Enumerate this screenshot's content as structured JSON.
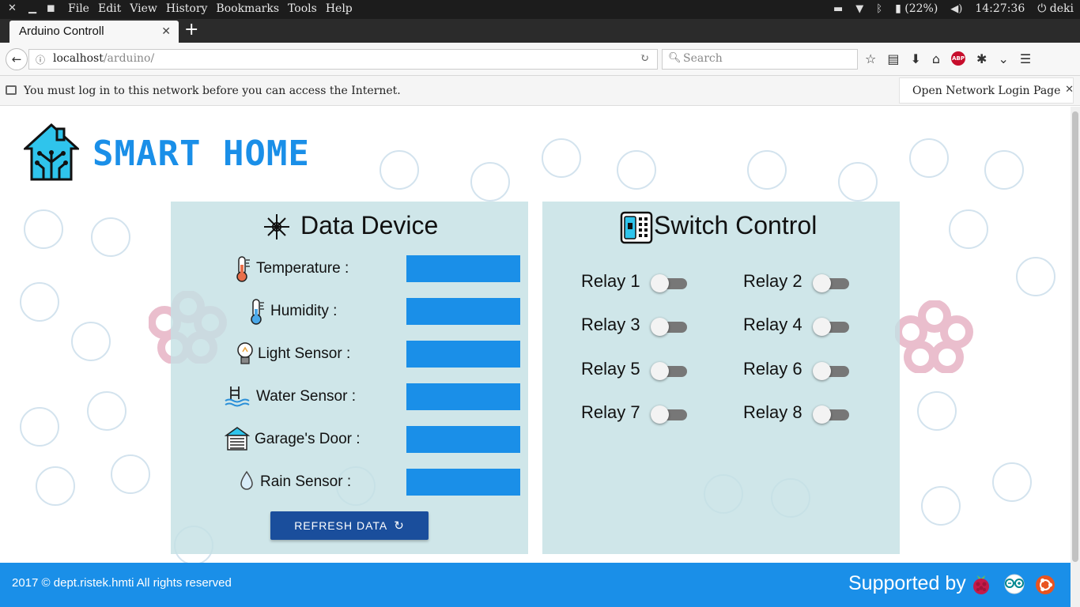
{
  "system_bar": {
    "menus": [
      "File",
      "Edit",
      "View",
      "History",
      "Bookmarks",
      "Tools",
      "Help"
    ],
    "battery": "(22%)",
    "clock": "14:27:36",
    "user": "deki"
  },
  "tab": {
    "title": "Arduino Controll"
  },
  "address": {
    "host": "localhost",
    "path": "/arduino/",
    "search_placeholder": "Search"
  },
  "notification": {
    "message": "You must log in to this network before you can access the Internet.",
    "button": "Open Network Login Page"
  },
  "brand": {
    "title": "SMART HOME"
  },
  "data_device": {
    "title": "Data Device",
    "sensors": [
      {
        "label": "Temperature :",
        "icon": "thermometer-icon",
        "value": ""
      },
      {
        "label": "Humidity :",
        "icon": "humidity-icon",
        "value": ""
      },
      {
        "label": "Light Sensor :",
        "icon": "bulb-icon",
        "value": ""
      },
      {
        "label": "Water Sensor :",
        "icon": "water-icon",
        "value": ""
      },
      {
        "label": "Garage's Door :",
        "icon": "garage-icon",
        "value": ""
      },
      {
        "label": "Rain Sensor :",
        "icon": "raindrop-icon",
        "value": ""
      }
    ],
    "refresh_label": "REFRESH DATA"
  },
  "switch_control": {
    "title": "Switch Control",
    "relays": [
      {
        "label": "Relay 1",
        "on": false
      },
      {
        "label": "Relay 2",
        "on": false
      },
      {
        "label": "Relay 3",
        "on": false
      },
      {
        "label": "Relay 4",
        "on": false
      },
      {
        "label": "Relay 5",
        "on": false
      },
      {
        "label": "Relay 6",
        "on": false
      },
      {
        "label": "Relay 7",
        "on": false
      },
      {
        "label": "Relay 8",
        "on": false
      }
    ]
  },
  "footer": {
    "copyright": "2017 © dept.ristek.hmti All rights reserved",
    "supported_by": "Supported by",
    "logos": [
      "raspberry-pi-icon",
      "arduino-icon",
      "ubuntu-icon"
    ]
  },
  "colors": {
    "accent": "#1a8fe8",
    "button": "#1a4e9c",
    "panel": "#c4e0e4"
  }
}
